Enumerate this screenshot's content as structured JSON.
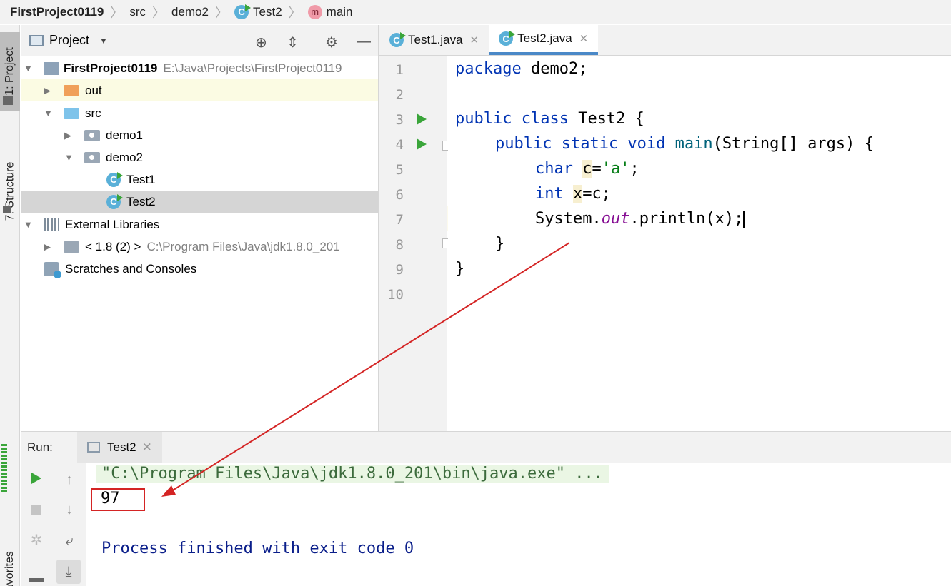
{
  "breadcrumb": {
    "project": "FirstProject0119",
    "src": "src",
    "package": "demo2",
    "class_icon": "C",
    "class": "Test2",
    "method_icon": "m",
    "method": "main"
  },
  "tool_stripe": {
    "project_tab": "1: Project",
    "structure_tab": "7: Structure",
    "favorites_tab": "Favorites"
  },
  "project_panel": {
    "title": "Project",
    "tree": [
      {
        "label": "FirstProject0119",
        "path": "E:\\Java\\Projects\\FirstProject0119",
        "icon": "module-icon",
        "expanded": true
      },
      {
        "label": "out",
        "icon": "folder-orange-icon",
        "expanded": false
      },
      {
        "label": "src",
        "icon": "folder-blue-icon",
        "expanded": true
      },
      {
        "label": "demo1",
        "icon": "package-icon",
        "expanded": false
      },
      {
        "label": "demo2",
        "icon": "package-icon",
        "expanded": true
      },
      {
        "label": "Test1",
        "icon": "java-class-icon"
      },
      {
        "label": "Test2",
        "icon": "java-class-icon",
        "selected": true
      },
      {
        "label": "External Libraries",
        "icon": "libraries-icon",
        "expanded": true
      },
      {
        "label": "< 1.8 (2) >",
        "path": "C:\\Program Files\\Java\\jdk1.8.0_201",
        "icon": "jdk-icon",
        "expanded": false
      },
      {
        "label": "Scratches and Consoles",
        "icon": "scratches-icon"
      }
    ]
  },
  "editor": {
    "tabs": [
      {
        "label": "Test1.java",
        "icon": "C",
        "active": false
      },
      {
        "label": "Test2.java",
        "icon": "C",
        "active": true
      }
    ],
    "line_numbers": [
      "1",
      "2",
      "3",
      "4",
      "5",
      "6",
      "7",
      "8",
      "9",
      "10"
    ],
    "code": {
      "l1_kw": "package",
      "l1_rest": " demo2;",
      "l3_kw": "public class",
      "l3_rest": " Test2 {",
      "l4_kw": "public static void",
      "l4_sp": " ",
      "l4_method": "main",
      "l4_rest": "(String[] args) {",
      "l5_kw": "char",
      "l5_var": "c",
      "l5_eq": "=",
      "l5_str": "'a'",
      "l5_end": ";",
      "l6_kw": "int",
      "l6_var": "x",
      "l6_rest": "=c;",
      "l7_a": "System.",
      "l7_field": "out",
      "l7_b": ".println(x);",
      "l8": "}",
      "l9": "}"
    },
    "current_line": "7"
  },
  "run_panel": {
    "label": "Run:",
    "tab": "Test2",
    "command": "\"C:\\Program Files\\Java\\jdk1.8.0_201\\bin\\java.exe\" ...",
    "output": "97",
    "finished": "Process finished with exit code 0"
  },
  "colors": {
    "keyword": "#0033b3",
    "string": "#067d17",
    "field": "#871094",
    "console_finished": "#0a1e8a",
    "annotation_red": "#d42424",
    "run_green": "#3aa53a"
  }
}
